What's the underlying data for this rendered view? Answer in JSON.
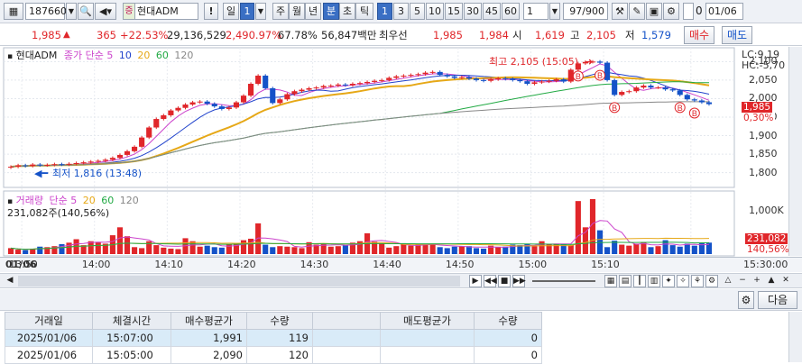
{
  "toolbar": {
    "code": "187660",
    "stock_name": "현대ADM",
    "name_prefix": "증",
    "exclaim": "!",
    "period_day": "일",
    "period_num": "1",
    "periods": [
      "주",
      "월",
      "년",
      "분",
      "초",
      "틱"
    ],
    "intervals": [
      "1",
      "3",
      "5",
      "10",
      "15",
      "30",
      "45",
      "60"
    ],
    "interval_input": "1",
    "count": "97/900",
    "checkbox_value": "0",
    "date": "01/06"
  },
  "quote": {
    "price": "1,985",
    "change": "365",
    "change_pct": "+22.53%",
    "volume": "29,136,529",
    "volume_pct": "2,490.97%",
    "turnover_pct": "67.78%",
    "amount": "56,847백만",
    "best_label": "최우선",
    "ask": "1,985",
    "bid": "1,984",
    "open_label": "시",
    "open": "1,619",
    "high_label": "고",
    "high": "2,105",
    "low_label": "저",
    "low": "1,579",
    "buy_button": "매수",
    "sell_button": "매도"
  },
  "price_legend": {
    "name": "현대ADM",
    "close_label": "종가",
    "ma_label": "단순",
    "ma_periods": [
      "5",
      "10",
      "20",
      "60",
      "120"
    ]
  },
  "volume_legend": {
    "label": "거래량",
    "ma_label": "단순",
    "ma_periods": [
      "5",
      "20",
      "60",
      "120"
    ],
    "current": "231,082주(140,56%)"
  },
  "annotations": {
    "high": "최고 2,105 (15:05)",
    "low": "최저 1,816 (13:48)",
    "lc": "LC:9,19",
    "hc": "HC:-5,70",
    "price_tag": "1,985",
    "pct_tag": "0,30%",
    "vol_tag": "231,082",
    "vol_pct_tag": "140,56%",
    "buy_marker": "B"
  },
  "colors": {
    "up": "#e0262a",
    "down": "#1452c8",
    "ma5": "#cc44cc",
    "ma10": "#2244cc",
    "ma20": "#e6a817",
    "ma60": "#22aa44",
    "ma120": "#888888"
  },
  "chart_data": {
    "type": "candlestick",
    "price_axis": {
      "ticks": [
        "2,100",
        "2,050",
        "2,000",
        "1,950",
        "1,900",
        "1,850",
        "1,800"
      ],
      "ylim": [
        1770,
        2130
      ]
    },
    "volume_axis": {
      "ticks": [
        "1,000K"
      ],
      "ylim": [
        0,
        1200000
      ]
    },
    "time_axis": {
      "date_label": "01/06",
      "ticks": [
        "13:50",
        "14:00",
        "14:10",
        "14:20",
        "14:30",
        "14:40",
        "14:50",
        "15:00",
        "15:10",
        "15:30:00"
      ]
    },
    "price": [
      1816,
      1820,
      1818,
      1822,
      1820,
      1821,
      1823,
      1822,
      1824,
      1826,
      1828,
      1830,
      1832,
      1835,
      1840,
      1848,
      1858,
      1870,
      1895,
      1922,
      1945,
      1955,
      1968,
      1975,
      1984,
      1990,
      1992,
      1986,
      1979,
      1972,
      1976,
      1990,
      2008,
      2040,
      2062,
      2028,
      1988,
      1998,
      2012,
      2020,
      2024,
      2028,
      2030,
      2034,
      2035,
      2038,
      2036,
      2040,
      2042,
      2045,
      2048,
      2050,
      2056,
      2060,
      2062,
      2064,
      2066,
      2070,
      2072,
      2064,
      2060,
      2056,
      2058,
      2054,
      2050,
      2048,
      2052,
      2055,
      2053,
      2050,
      2047,
      2040,
      2044,
      2046,
      2048,
      2052,
      2046,
      2078,
      2095,
      2099,
      2100,
      2097,
      2050,
      2010,
      2018,
      2020,
      2030,
      2035,
      2030,
      2030,
      2025,
      2022,
      2010,
      1998,
      1995,
      1990,
      1985
    ],
    "volume": [
      120000,
      90000,
      80000,
      110000,
      150000,
      140000,
      160000,
      200000,
      230000,
      300000,
      180000,
      260000,
      240000,
      210000,
      380000,
      540000,
      360000,
      140000,
      120000,
      260000,
      180000,
      130000,
      110000,
      100000,
      320000,
      260000,
      150000,
      170000,
      140000,
      130000,
      200000,
      220000,
      280000,
      310000,
      620000,
      190000,
      140000,
      160000,
      150000,
      140000,
      120000,
      240000,
      190000,
      210000,
      150000,
      160000,
      180000,
      230000,
      260000,
      420000,
      250000,
      210000,
      130000,
      160000,
      220000,
      170000,
      190000,
      200000,
      210000,
      140000,
      120000,
      150000,
      160000,
      160000,
      120000,
      110000,
      170000,
      140000,
      150000,
      190000,
      180000,
      200000,
      160000,
      260000,
      200000,
      210000,
      190000,
      180000,
      1070000,
      540000,
      1110000,
      480000,
      140000,
      270000,
      190000,
      170000,
      210000,
      240000,
      140000,
      160000,
      280000,
      180000,
      150000,
      210000,
      170000,
      220000,
      231082
    ]
  },
  "scroll_icons": [
    "grid-icon",
    "settings-icon",
    "zoom-in-icon",
    "zoom-out-icon"
  ],
  "panel": {
    "next_button": "다음"
  },
  "table": {
    "headers": [
      "거래일",
      "체결시간",
      "매수평균가",
      "수량",
      "",
      "매도평균가",
      "수량"
    ],
    "rows": [
      [
        "2025/01/06",
        "15:07:00",
        "1,991",
        "119",
        "",
        "",
        "0"
      ],
      [
        "2025/01/06",
        "15:05:00",
        "2,090",
        "120",
        "",
        "",
        "0"
      ]
    ]
  }
}
